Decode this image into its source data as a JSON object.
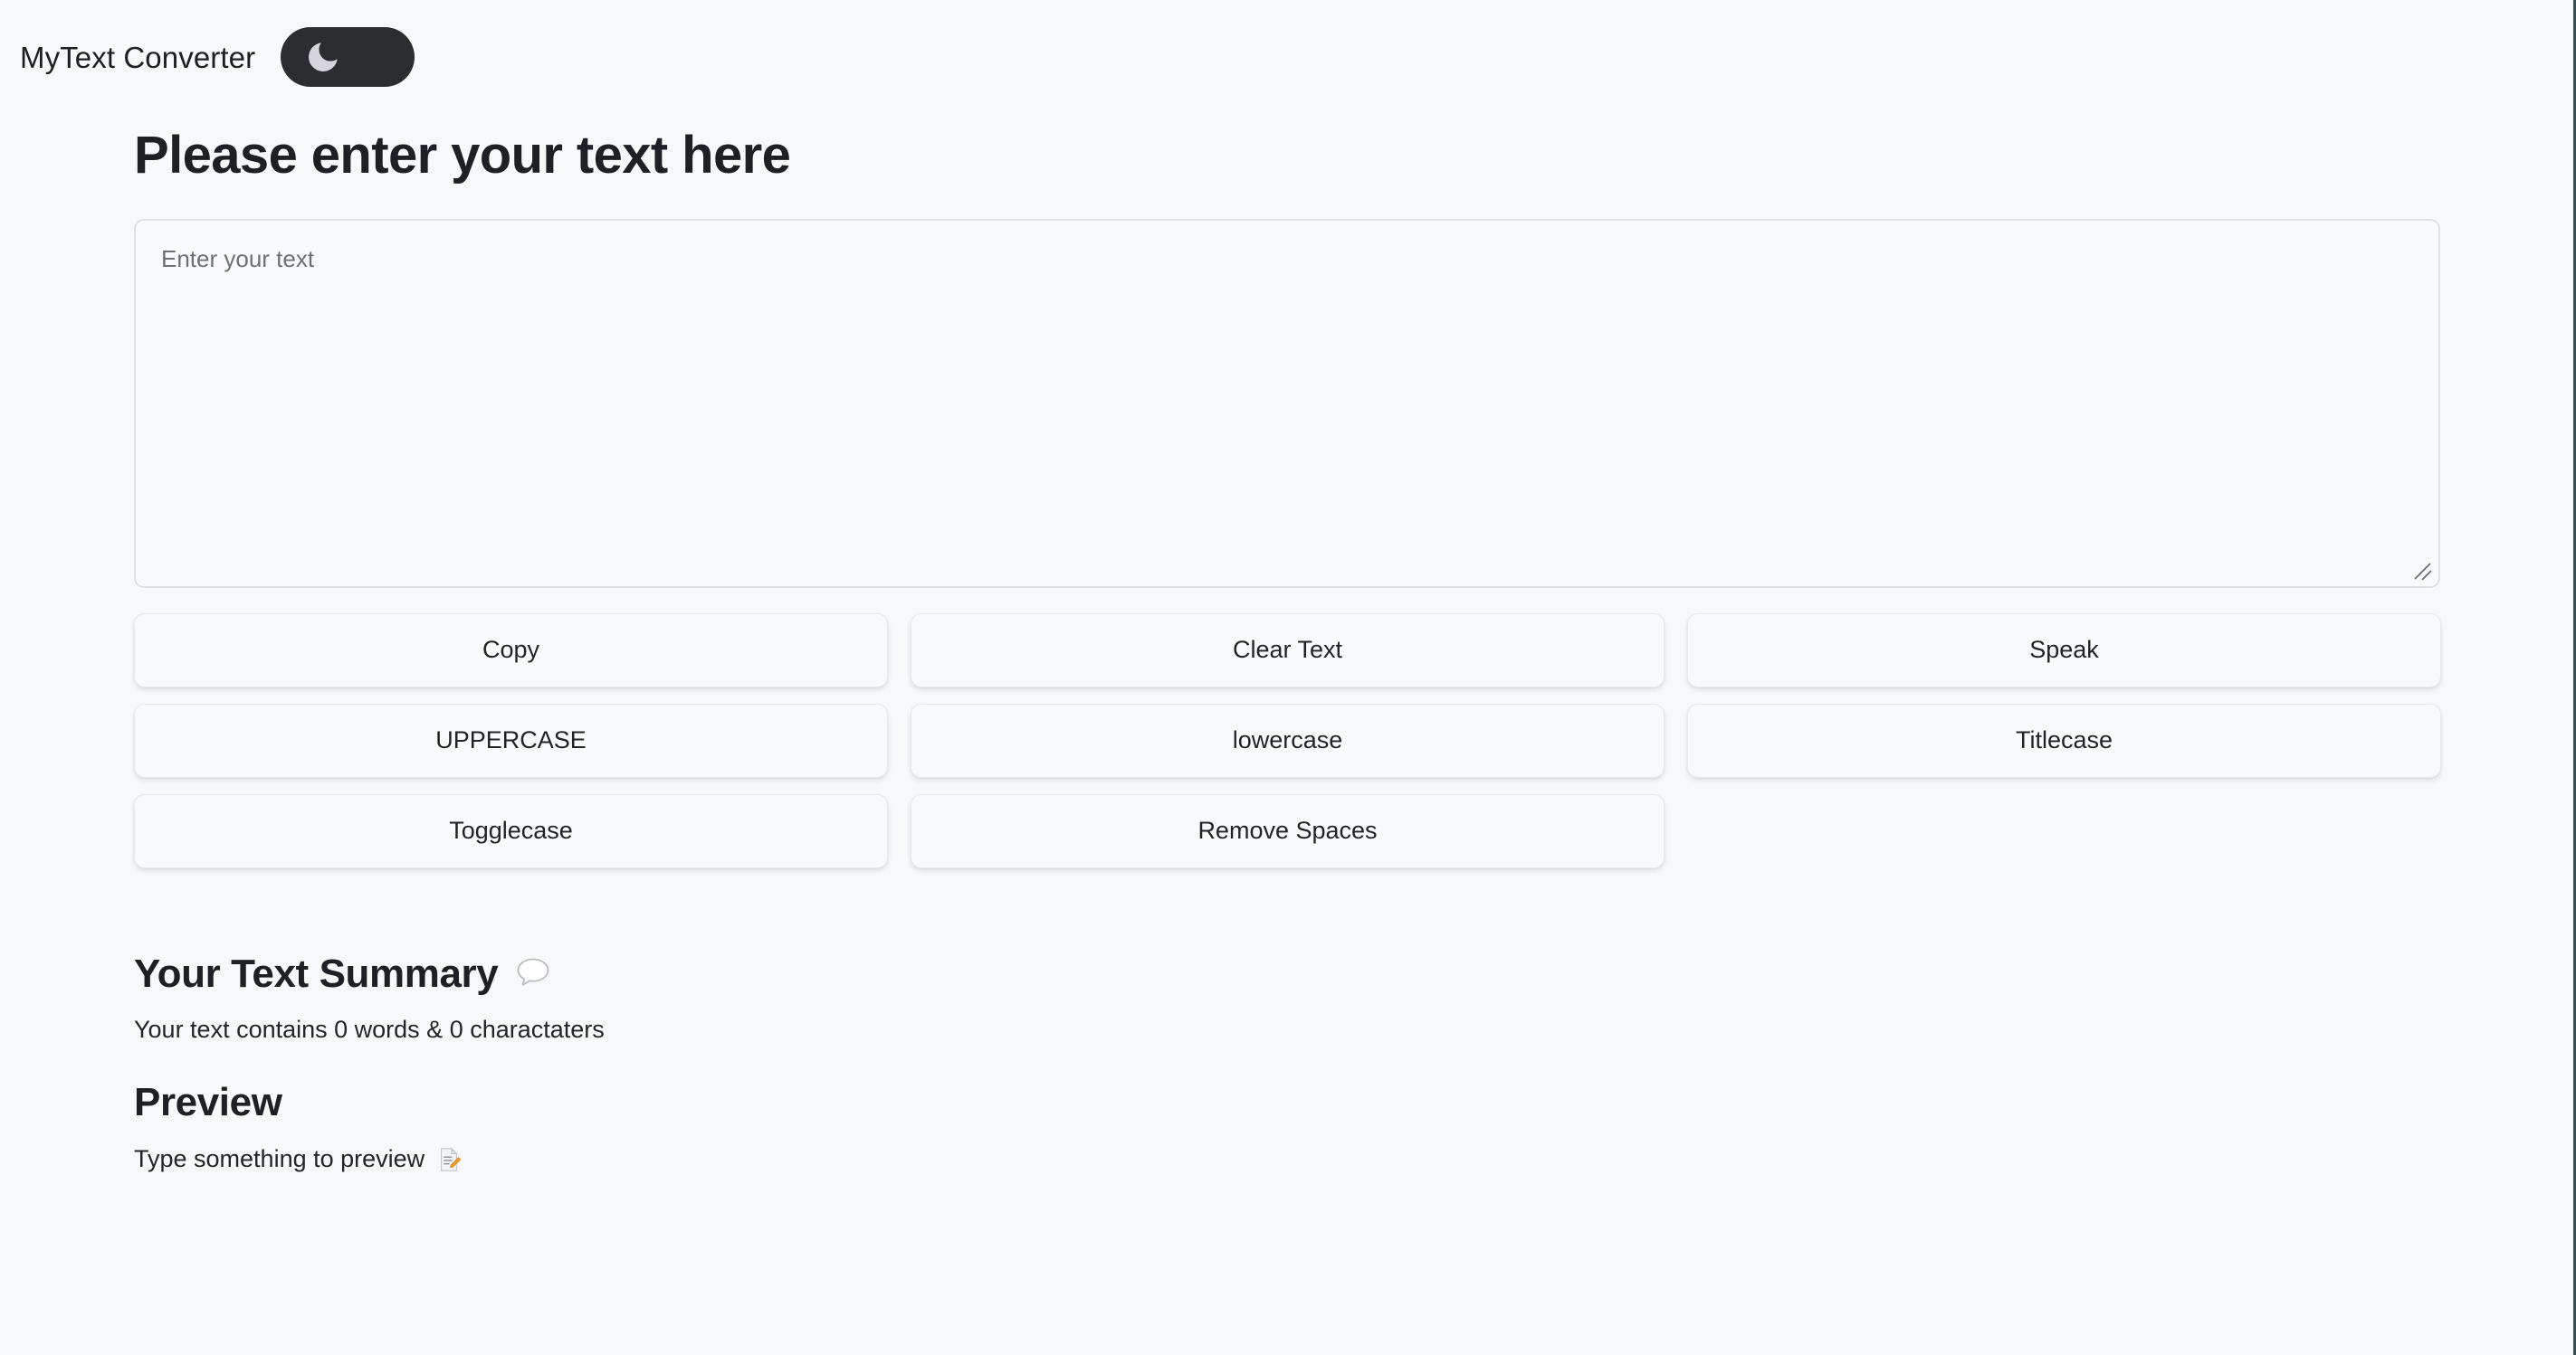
{
  "header": {
    "brand": "MyText Converter",
    "theme_toggle": {
      "name": "dark-mode-toggle",
      "icon": "moon-icon",
      "state": "dark",
      "track_color": "#2b2d31",
      "moon_color": "#d6d5dc"
    }
  },
  "main": {
    "title": "Please enter your text here",
    "textarea": {
      "value": "",
      "placeholder": "Enter your text"
    },
    "buttons": [
      {
        "label": "Copy",
        "name": "copy-button"
      },
      {
        "label": "Clear Text",
        "name": "clear-text-button"
      },
      {
        "label": "Speak",
        "name": "speak-button"
      },
      {
        "label": "UPPERCASE",
        "name": "uppercase-button"
      },
      {
        "label": "lowercase",
        "name": "lowercase-button"
      },
      {
        "label": "Titlecase",
        "name": "titlecase-button"
      },
      {
        "label": "Togglecase",
        "name": "togglecase-button"
      },
      {
        "label": "Remove Spaces",
        "name": "remove-spaces-button"
      }
    ]
  },
  "summary": {
    "title": "Your Text Summary",
    "title_icon": "speech-balloon-icon",
    "stats_text": "Your text contains 0 words & 0 charactaters",
    "word_count": 0,
    "character_count": 0
  },
  "preview": {
    "title": "Preview",
    "empty_text": "Type something to preview",
    "icon": "memo-pencil-icon"
  },
  "colors": {
    "page_background": "#f6f8fa",
    "text": "#22262b",
    "muted_text": "#6b7178",
    "border": "#dde0e4",
    "button_background": "#f7f9fb",
    "toggle_track": "#2b2d31"
  }
}
